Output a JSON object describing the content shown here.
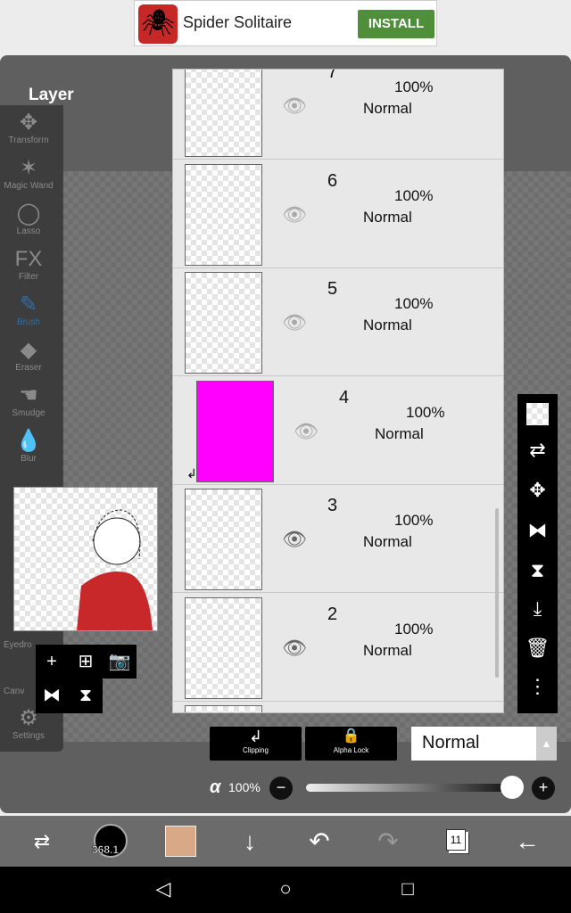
{
  "ad": {
    "name": "Spider Solitaire",
    "install": "INSTALL",
    "icon": "spider-icon"
  },
  "panel_title": "Layer",
  "tools": [
    {
      "label": "Transform",
      "icon": "✥"
    },
    {
      "label": "Magic Wand",
      "icon": "✶"
    },
    {
      "label": "Lasso",
      "icon": "◯"
    },
    {
      "label": "Filter",
      "icon": "FX"
    },
    {
      "label": "Brush",
      "icon": "✎"
    },
    {
      "label": "Eraser",
      "icon": "◆"
    },
    {
      "label": "Smudge",
      "icon": "☚"
    },
    {
      "label": "Blur",
      "icon": "💧"
    }
  ],
  "tools_bottom": [
    {
      "label": "Eyedro"
    },
    {
      "label": "Canv"
    },
    {
      "label": "Settings",
      "icon": "⚙"
    }
  ],
  "layers": [
    {
      "num": "7",
      "opacity": "100%",
      "blend": "Normal",
      "visible": false
    },
    {
      "num": "6",
      "opacity": "100%",
      "blend": "Normal",
      "visible": false
    },
    {
      "num": "5",
      "opacity": "100%",
      "blend": "Normal",
      "visible": false
    },
    {
      "num": "4",
      "opacity": "100%",
      "blend": "Normal",
      "visible": false,
      "clipped": true,
      "color": "#ff00ff"
    },
    {
      "num": "3",
      "opacity": "100%",
      "blend": "Normal",
      "visible": true
    },
    {
      "num": "2",
      "opacity": "100%",
      "blend": "Normal",
      "visible": true
    }
  ],
  "buttons": {
    "clipping": "Clipping",
    "alpha_lock": "Alpha Lock",
    "blend_mode": "Normal"
  },
  "opacity": {
    "symbol": "α",
    "value": "100%",
    "fraction": 1.0
  },
  "toolbar": {
    "brush_size": "368.1",
    "color": "#d9a886",
    "layer_count": "11"
  }
}
